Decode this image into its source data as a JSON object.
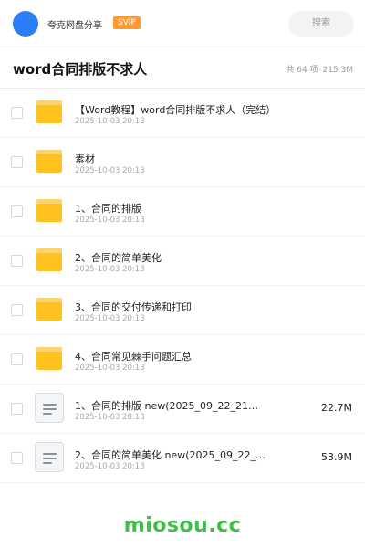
{
  "header": {
    "share_name": "夸克网盘分享",
    "badge": "SVIP",
    "search_label": "搜索"
  },
  "folder": {
    "title": "word合同排版不求人",
    "count": "共 64 项",
    "separator": "·",
    "total_size": "215.3M"
  },
  "items": [
    {
      "type": "folder",
      "name": "【Word教程】word合同排版不求人（完结）",
      "date": "2025-10-03 20:13",
      "size": ""
    },
    {
      "type": "folder",
      "name": "素材",
      "date": "2025-10-03 20:13",
      "size": ""
    },
    {
      "type": "folder",
      "name": "1、合同的排版",
      "date": "2025-10-03 20:13",
      "size": ""
    },
    {
      "type": "folder",
      "name": "2、合同的简单美化",
      "date": "2025-10-03 20:13",
      "size": ""
    },
    {
      "type": "folder",
      "name": "3、合同的交付传递和打印",
      "date": "2025-10-03 20:13",
      "size": ""
    },
    {
      "type": "folder",
      "name": "4、合同常见棘手问题汇总",
      "date": "2025-10-03 20:13",
      "size": ""
    },
    {
      "type": "file",
      "name": "1、合同的排版 new(2025_09_22_21…",
      "date": "2025-10-03 20:13",
      "size": "22.7M"
    },
    {
      "type": "file",
      "name": "2、合同的简单美化 new(2025_09_22_…",
      "date": "2025-10-03 20:13",
      "size": "53.9M"
    }
  ],
  "watermark": "miosou.cc",
  "colors": {
    "avatar": "#2c7ef8",
    "svip": "#ff9a2e",
    "folder": "#ffc21f",
    "watermark": "#3fbf4a"
  }
}
